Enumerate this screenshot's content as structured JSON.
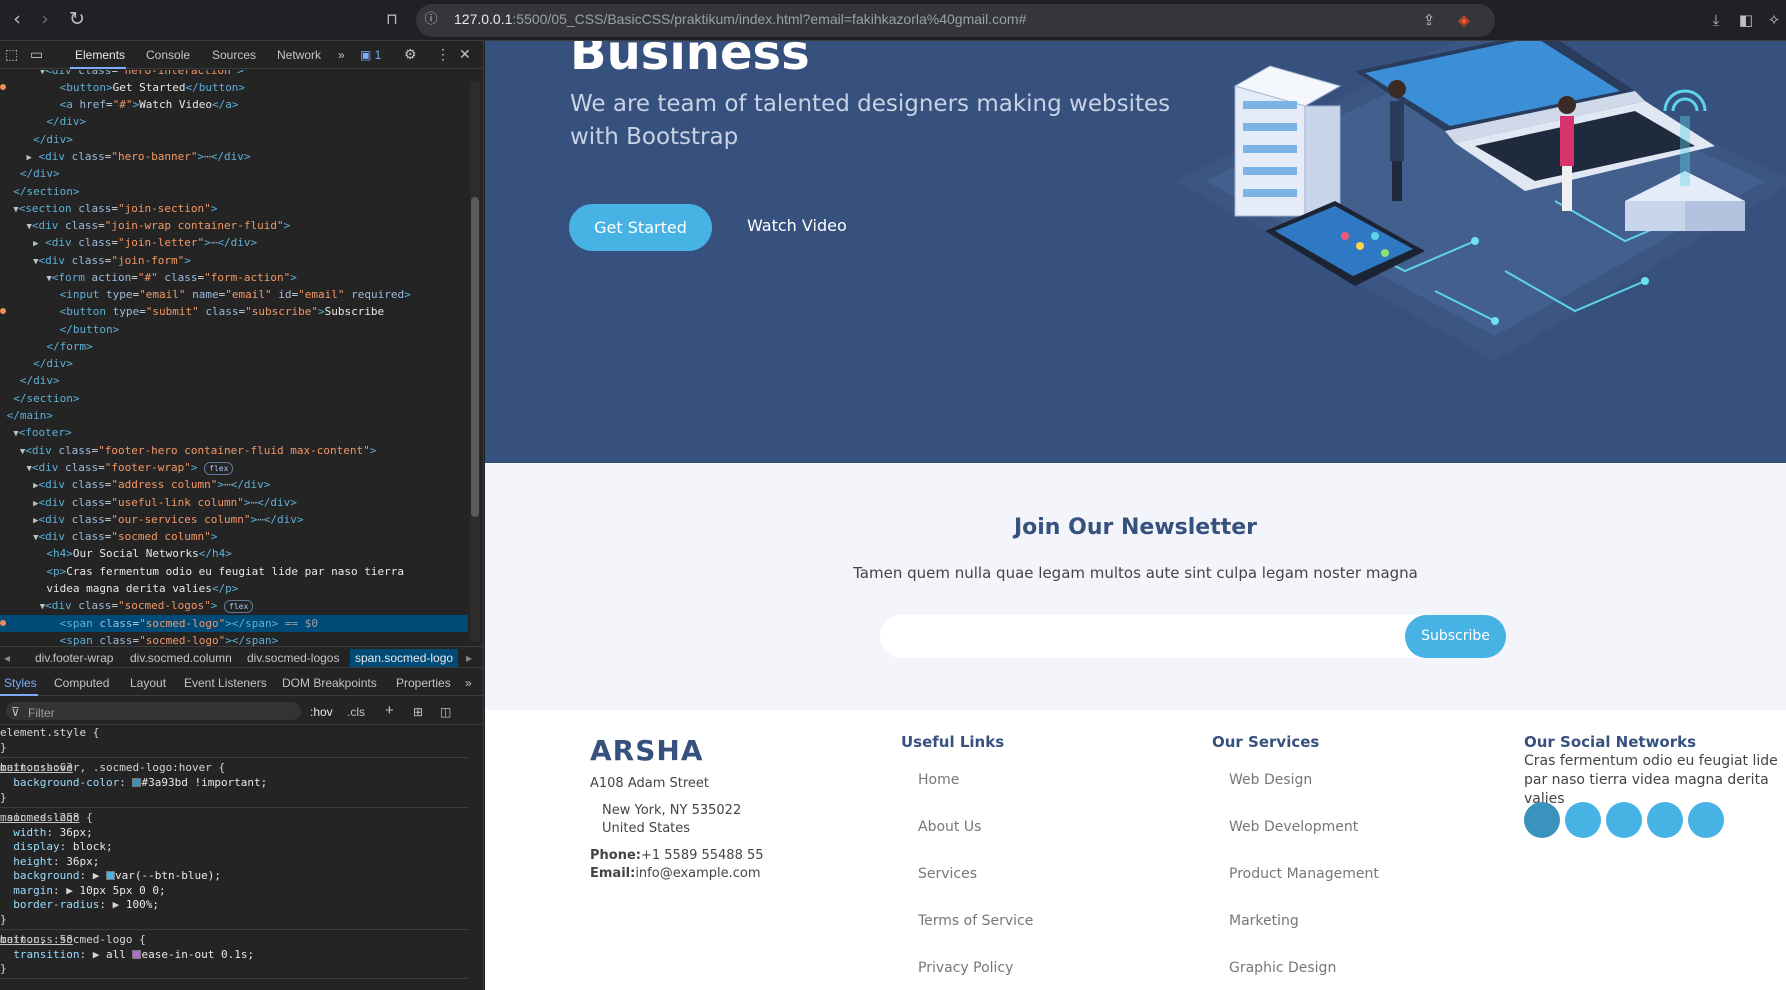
{
  "browser": {
    "url_host": "127.0.0.1",
    "url_rest": ":5500/05_CSS/BasicCSS/praktikum/index.html?email=fakihkazorla%40gmail.com#"
  },
  "devtools": {
    "tabs": [
      "Elements",
      "Console",
      "Sources",
      "Network"
    ],
    "issues_count": "1",
    "dom": {
      "l0_text": "Get Started",
      "l1_text": "Watch Video",
      "l2_class": "hero-banner",
      "l3_class": "join-section",
      "l4_class": "join-wrap container-fluid",
      "l5_class": "join-letter",
      "l6_class": "join-form",
      "l7_action": "#",
      "l7_class": "form-action",
      "l8_type": "email",
      "l8_name": "email",
      "l8_id": "email",
      "l9_type": "submit",
      "l9_class": "subscribe",
      "l9_text": "Subscribe",
      "l10_class": "footer-hero container-fluid max-content",
      "l11_class": "footer-wrap",
      "l12_class": "address column",
      "l13_class": "useful-link column",
      "l14_class": "our-services column",
      "l15_class": "socmed column",
      "l16_text": "Our Social Networks",
      "l17_text": "Cras fermentum odio eu feugiat lide par naso tierra",
      "l18_text": "videa magna derita valies",
      "l19_class": "socmed-logos",
      "l20_class": "socmed-logo",
      "flex_badge": "flex",
      "selected_suffix": "== $0"
    },
    "breadcrumbs": [
      "div.footer-wrap",
      "div.socmed.column",
      "div.socmed-logos",
      "span.socmed-logo"
    ],
    "style_tabs": [
      "Styles",
      "Computed",
      "Layout",
      "Event Listeners",
      "DOM Breakpoints",
      "Properties"
    ],
    "filter_placeholder": "Filter",
    "hov_label": ":hov",
    "cls_label": ".cls",
    "rules": {
      "element_style": "element.style {",
      "r1_selector": "button:hover, .socmed-logo:hover {",
      "r1_source": "main.css:63",
      "r1_prop": "background-color",
      "r1_value": "#3a93bd !important;",
      "r1_color": "#3a93bd",
      "r2_selector": ".socmed-logo {",
      "r2_source": "main.css:258",
      "r2_width": "36px;",
      "r2_display": "block;",
      "r2_height": "36px;",
      "r2_background": "var(--btn-blue);",
      "r2_margin": "10px 5px 0 0;",
      "r2_radius": "100%;",
      "r3_selector": "button, .socmed-logo {",
      "r3_source": "main.css:58",
      "r3_transition": "all",
      "r3_transition2": "ease-in-out 0.1s;"
    }
  },
  "page": {
    "colors": {
      "primary": "#37517e",
      "accent": "#47b2e4",
      "hover": "#3a93bd"
    },
    "hero": {
      "title": "Business",
      "subtitle": "We are team of talented designers making websites with Bootstrap",
      "get_started": "Get Started",
      "watch_video": "Watch Video"
    },
    "newsletter": {
      "title": "Join Our Newsletter",
      "description": "Tamen quem nulla quae legam multos aute sint culpa legam noster magna",
      "subscribe": "Subscribe"
    },
    "footer": {
      "brand": "ARSHA",
      "street": "A108 Adam Street",
      "city": "New York, NY 535022",
      "country": "United States",
      "phone_label": "Phone:",
      "phone": "+1 5589 55488 55",
      "email_label": "Email:",
      "email": "info@example.com",
      "useful_links_title": "Useful Links",
      "useful_links": [
        "Home",
        "About Us",
        "Services",
        "Terms of Service",
        "Privacy Policy"
      ],
      "services_title": "Our Services",
      "services": [
        "Web Design",
        "Web Development",
        "Product Management",
        "Marketing",
        "Graphic Design"
      ],
      "social_title": "Our Social Networks",
      "social_text": "Cras fermentum odio eu feugiat lide par naso tierra videa magna derita valies",
      "social_icons": [
        "socmed-logo",
        "socmed-logo",
        "socmed-logo",
        "socmed-logo",
        "socmed-logo"
      ]
    }
  }
}
